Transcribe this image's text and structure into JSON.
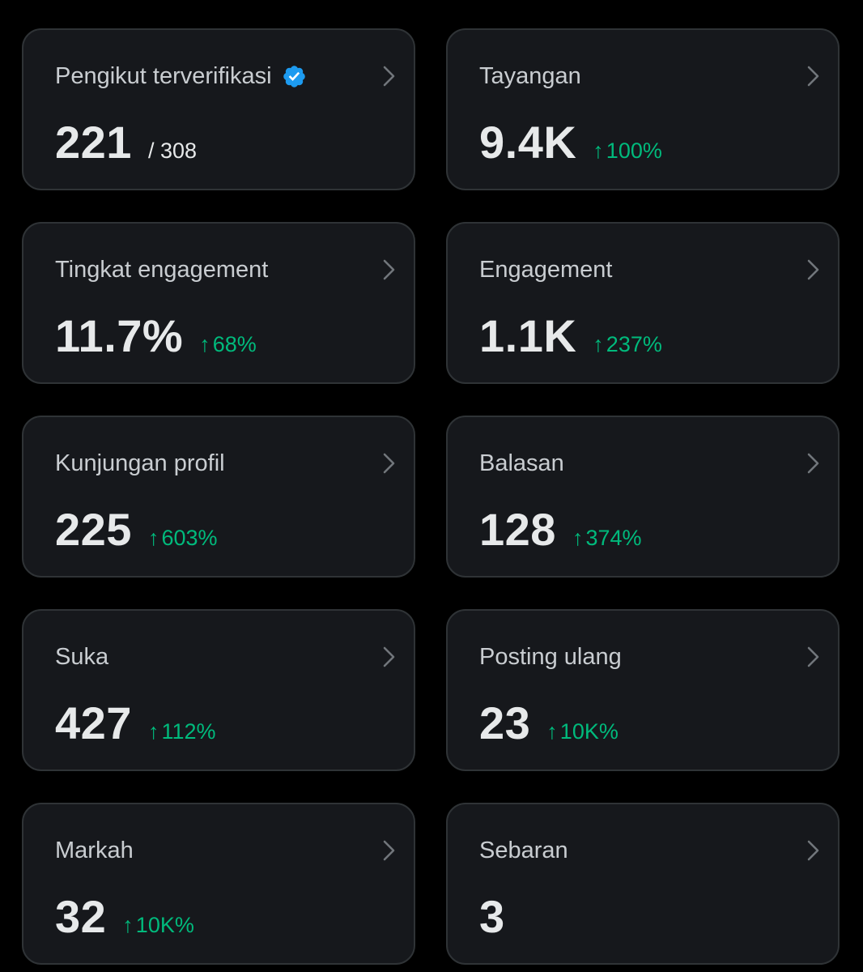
{
  "colors": {
    "background": "#000000",
    "card_background": "#16181c",
    "card_border": "#2f3336",
    "title_text": "#c9cdd1",
    "value_text": "#e7e9ea",
    "positive_change": "#00ba7c",
    "verified_badge": "#1d9bf0"
  },
  "icons": {
    "verified": "verified-badge-icon",
    "chevron": "chevron-right-icon",
    "arrow_up": "↑"
  },
  "cards": [
    {
      "title": "Pengikut terverifikasi",
      "value": "221",
      "sub": "/ 308",
      "change": ""
    },
    {
      "title": "Tayangan",
      "value": "9.4K",
      "sub": "",
      "change": "100%"
    },
    {
      "title": "Tingkat engagement",
      "value": "11.7%",
      "sub": "",
      "change": "68%"
    },
    {
      "title": "Engagement",
      "value": "1.1K",
      "sub": "",
      "change": "237%"
    },
    {
      "title": "Kunjungan profil",
      "value": "225",
      "sub": "",
      "change": "603%"
    },
    {
      "title": "Balasan",
      "value": "128",
      "sub": "",
      "change": "374%"
    },
    {
      "title": "Suka",
      "value": "427",
      "sub": "",
      "change": "112%"
    },
    {
      "title": "Posting ulang",
      "value": "23",
      "sub": "",
      "change": "10K%"
    },
    {
      "title": "Markah",
      "value": "32",
      "sub": "",
      "change": "10K%"
    },
    {
      "title": "Sebaran",
      "value": "3",
      "sub": "",
      "change": ""
    }
  ]
}
